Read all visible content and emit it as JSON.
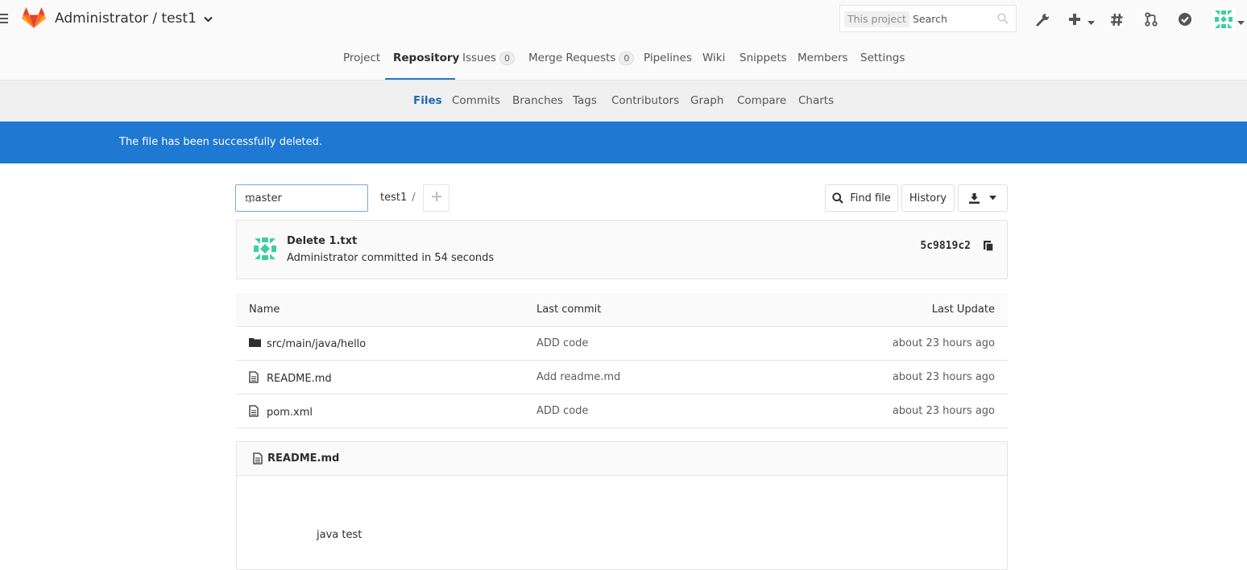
{
  "header": {
    "title": "Administrator / test1",
    "search_scope": "This project",
    "search_placeholder": "Search"
  },
  "nav": {
    "tabs": [
      {
        "label": "Project"
      },
      {
        "label": "Repository",
        "active": true
      },
      {
        "label": "Issues",
        "badge": "0"
      },
      {
        "label": "Merge Requests",
        "badge": "0"
      },
      {
        "label": "Pipelines"
      },
      {
        "label": "Wiki"
      },
      {
        "label": "Snippets"
      },
      {
        "label": "Members"
      },
      {
        "label": "Settings"
      }
    ],
    "subtabs": [
      {
        "label": "Files",
        "active": true
      },
      {
        "label": "Commits"
      },
      {
        "label": "Branches"
      },
      {
        "label": "Tags"
      },
      {
        "label": "Contributors"
      },
      {
        "label": "Graph"
      },
      {
        "label": "Compare"
      },
      {
        "label": "Charts"
      }
    ]
  },
  "flash": {
    "message": "The file has been successfully deleted."
  },
  "toolbar": {
    "branch": "master",
    "path_root": "test1",
    "path_sep": "/",
    "find_file": "Find file",
    "history": "History"
  },
  "commit": {
    "title": "Delete 1.txt",
    "meta": "Administrator committed in 54 seconds",
    "sha": "5c9819c2"
  },
  "tree": {
    "headers": {
      "name": "Name",
      "last_commit": "Last commit",
      "last_update": "Last Update"
    },
    "rows": [
      {
        "name": "src/main/java/hello",
        "type": "folder",
        "commit": "ADD code",
        "updated": "about 23 hours ago"
      },
      {
        "name": "README.md",
        "type": "file",
        "commit": "Add readme.md",
        "updated": "about 23 hours ago"
      },
      {
        "name": "pom.xml",
        "type": "file",
        "commit": "ADD code",
        "updated": "about 23 hours ago"
      }
    ]
  },
  "readme": {
    "filename": "README.md",
    "content": "java test"
  },
  "colors": {
    "accent": "#1f78d1",
    "logo": "#e24329"
  }
}
